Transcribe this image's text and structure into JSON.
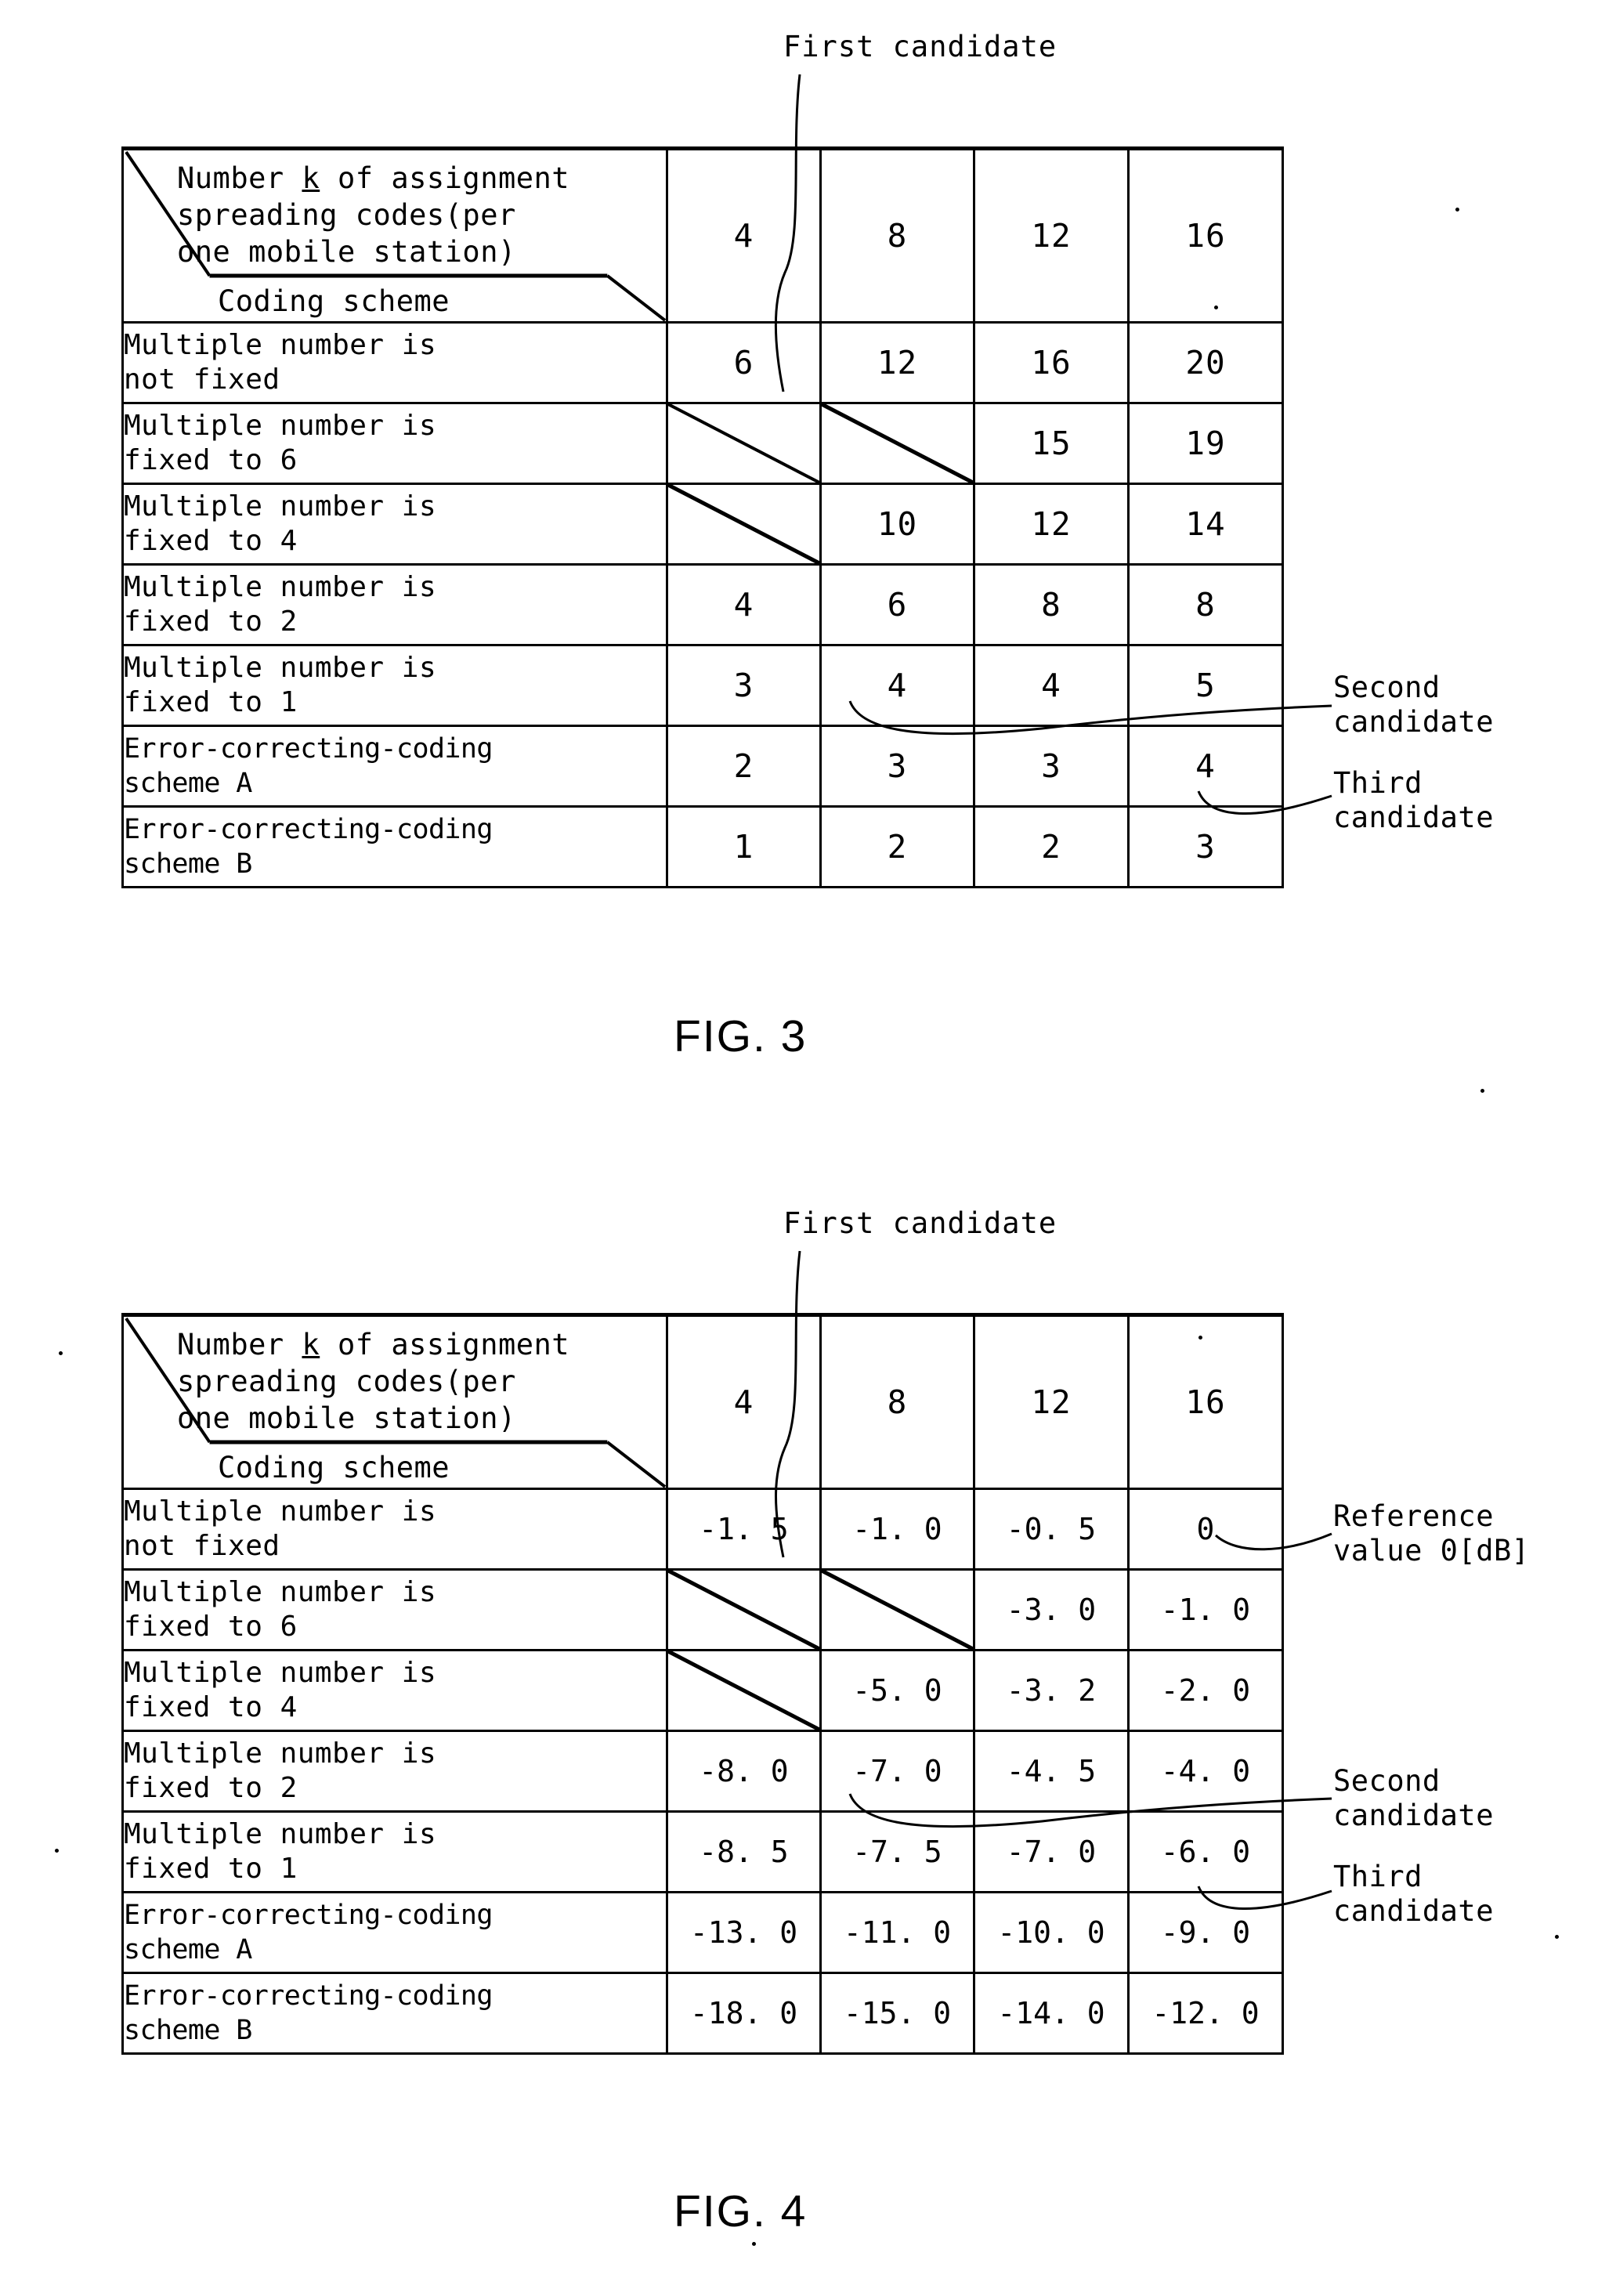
{
  "figures": [
    {
      "id": "fig3",
      "caption": "FIG. 3",
      "first_candidate_label": "First candidate",
      "header": {
        "column_header": "Number k of assignment\nspreading codes(per\none mobile station)",
        "column_header_underlined_token": "k",
        "row_header": "Coding scheme"
      },
      "annotations": [
        {
          "name": "second-candidate",
          "text": "Second\ncandidate"
        },
        {
          "name": "third-candidate",
          "text": "Third\ncandidate"
        }
      ],
      "chart_data": {
        "type": "table",
        "title": "FIG. 3",
        "xlabel": "Number k of assignment spreading codes(per one mobile station)",
        "ylabel": "Coding scheme",
        "categories": [
          "4",
          "8",
          "12",
          "16"
        ],
        "rows": [
          {
            "label": "Multiple number is\nnot fixed",
            "values": [
              "6",
              "12",
              "16",
              "20"
            ]
          },
          {
            "label": "Multiple number is\nfixed to 6",
            "values": [
              "",
              "",
              "15",
              "19"
            ]
          },
          {
            "label": "Multiple number is\nfixed to 4",
            "values": [
              "",
              "10",
              "12",
              "14"
            ]
          },
          {
            "label": "Multiple number is\nfixed to 2",
            "values": [
              "4",
              "6",
              "8",
              "8"
            ]
          },
          {
            "label": "Multiple number is\nfixed to 1",
            "values": [
              "3",
              "4",
              "4",
              "5"
            ]
          },
          {
            "label": "Error-correcting-coding\nscheme A",
            "values": [
              "2",
              "3",
              "3",
              "4"
            ]
          },
          {
            "label": "Error-correcting-coding\nscheme B",
            "values": [
              "1",
              "2",
              "2",
              "3"
            ]
          }
        ],
        "struck_cells": [
          [
            1,
            0
          ],
          [
            1,
            1
          ],
          [
            2,
            0
          ]
        ],
        "annotated_cells": {
          "first_candidate": {
            "row": 0,
            "col": 0,
            "value": "6"
          },
          "second_candidate": {
            "row": 3,
            "col": 1,
            "value": "6"
          },
          "third_candidate": {
            "row": 4,
            "col": 3,
            "value": "5"
          }
        }
      }
    },
    {
      "id": "fig4",
      "caption": "FIG. 4",
      "first_candidate_label": "First candidate",
      "header": {
        "column_header": "Number k of assignment\nspreading codes(per\none mobile station)",
        "column_header_underlined_token": "k",
        "row_header": "Coding scheme"
      },
      "annotations": [
        {
          "name": "reference-value",
          "text": "Reference\nvalue 0[dB]"
        },
        {
          "name": "second-candidate",
          "text": "Second\ncandidate"
        },
        {
          "name": "third-candidate",
          "text": "Third\ncandidate"
        }
      ],
      "chart_data": {
        "type": "table",
        "title": "FIG. 4",
        "xlabel": "Number k of assignment spreading codes(per one mobile station)",
        "ylabel": "Coding scheme",
        "units": "dB",
        "categories": [
          "4",
          "8",
          "12",
          "16"
        ],
        "rows": [
          {
            "label": "Multiple number is\nnot fixed",
            "values": [
              "-1. 5",
              "-1. 0",
              "-0. 5",
              "0"
            ]
          },
          {
            "label": "Multiple number is\nfixed to 6",
            "values": [
              "",
              "",
              "-3. 0",
              "-1. 0"
            ]
          },
          {
            "label": "Multiple number is\nfixed to 4",
            "values": [
              "",
              "-5. 0",
              "-3. 2",
              "-2. 0"
            ]
          },
          {
            "label": "Multiple number is\nfixed to 2",
            "values": [
              "-8. 0",
              "-7. 0",
              "-4. 5",
              "-4. 0"
            ]
          },
          {
            "label": "Multiple number is\nfixed to 1",
            "values": [
              "-8. 5",
              "-7. 5",
              "-7. 0",
              "-6. 0"
            ]
          },
          {
            "label": "Error-correcting-coding\nscheme A",
            "values": [
              "-13. 0",
              "-11. 0",
              "-10. 0",
              "-9. 0"
            ]
          },
          {
            "label": "Error-correcting-coding\nscheme B",
            "values": [
              "-18. 0",
              "-15. 0",
              "-14. 0",
              "-12. 0"
            ]
          }
        ],
        "struck_cells": [
          [
            1,
            0
          ],
          [
            1,
            1
          ],
          [
            2,
            0
          ]
        ],
        "annotated_cells": {
          "first_candidate": {
            "row": 0,
            "col": 0,
            "value": "-1. 5"
          },
          "reference_value": {
            "row": 0,
            "col": 3,
            "value": "0"
          },
          "second_candidate": {
            "row": 3,
            "col": 1,
            "value": "-7. 0"
          },
          "third_candidate": {
            "row": 4,
            "col": 3,
            "value": "-6. 0"
          }
        }
      }
    }
  ]
}
